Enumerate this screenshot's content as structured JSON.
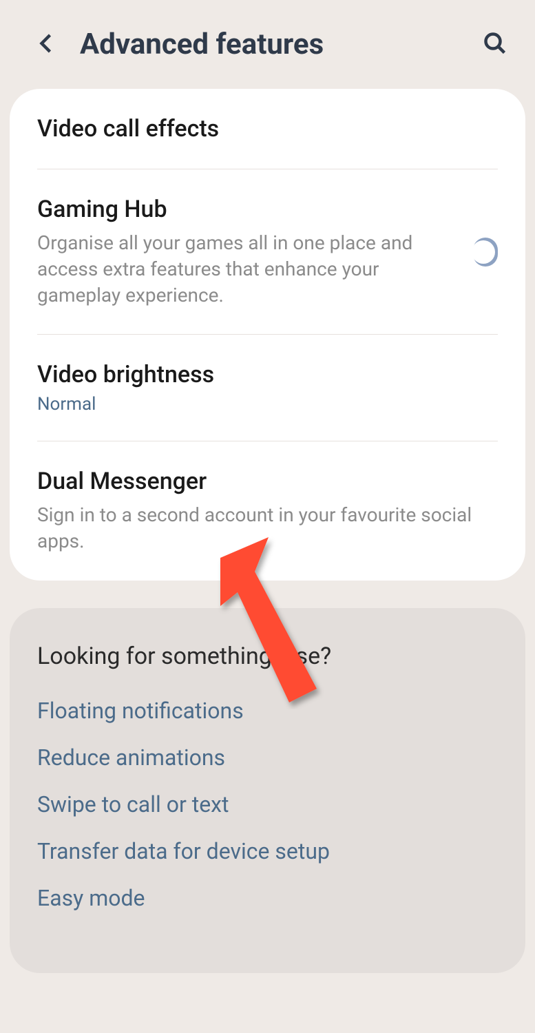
{
  "header": {
    "title": "Advanced features"
  },
  "card": {
    "items": [
      {
        "title": "Video call effects",
        "desc": "",
        "value": "",
        "toggle": false
      },
      {
        "title": "Gaming Hub",
        "desc": "Organise all your games all in one place and access extra features that enhance your gameplay experience.",
        "value": "",
        "toggle": true,
        "toggleOn": true
      },
      {
        "title": "Video brightness",
        "desc": "",
        "value": "Normal",
        "toggle": false
      },
      {
        "title": "Dual Messenger",
        "desc": "Sign in to a second account in your favourite social apps.",
        "value": "",
        "toggle": false
      }
    ]
  },
  "secondary": {
    "heading": "Looking for something else?",
    "links": [
      "Floating notifications",
      "Reduce animations",
      "Swipe to call or text",
      "Transfer data for device setup",
      "Easy mode"
    ]
  }
}
